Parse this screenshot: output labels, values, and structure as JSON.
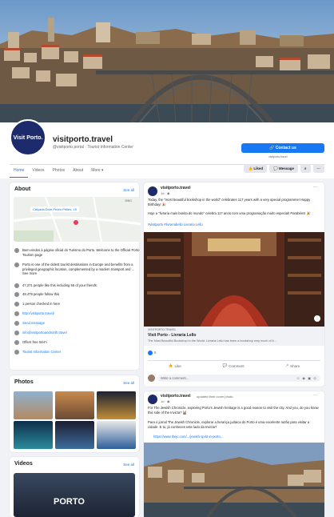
{
  "page": {
    "name": "visitporto.travel",
    "handle": "@visitporto.portal · Tourist Information Center",
    "avatar_text": [
      "Visit",
      "Porto."
    ],
    "contact_label": "Contact us",
    "contact_sub": "visitporto.travel",
    "tabs": [
      "Home",
      "Videos",
      "Photos",
      "About",
      "More ▾"
    ],
    "liked_label": "Liked",
    "message_label": "Message"
  },
  "about": {
    "title": "About",
    "see_all": "See all",
    "map_label": "Calçada Dom Pedro Pitões, 15",
    "map_watermark": "BING",
    "rows": [
      "Bem-vindos à página oficial do Turismo do Porto. Welcome to the Official Porto Tourism page",
      "Porto is one of the oldest tourist destinations in Europe and benefits from a privileged geographic location, complemented by a modern transport and ... See more",
      "47,271 people like this including 55 of your friends",
      "48,479 people follow this",
      "1 person checked in here",
      "http://visitporto.travel/",
      "Send message",
      "info@visitportoandnorth.travel",
      "Offers free Wi-Fi",
      "Tourist Information Center"
    ]
  },
  "photos": {
    "title": "Photos",
    "see_all": "See all"
  },
  "videos": {
    "title": "Videos",
    "see_all": "See all",
    "thumb_text": "PORTO"
  },
  "post1": {
    "author": "visitporto.travel",
    "time": "1d · ◉",
    "text_en": "Today, the \"most beautiful bookshop in the world\" celebrates 117 years with a very special programme! Happy Birthday! 🎉",
    "text_pt": "Hoje a \"livraria mais bonita do mundo\" celebra 117 anos com uma programação muito especial! Parabéns! 🎉",
    "tags": "#visitporto #livrariabello Livraria Lello",
    "link_domain": "VISITPORTO.TRAVEL",
    "link_title": "Visit Porto - Livraria Lello",
    "link_desc": "The Most Beautiful Bookshop in the World. Livraria Lello has been a bookshop very much of it...",
    "reactions": "5",
    "actions": [
      "Like",
      "Comment",
      "Share"
    ],
    "comment_placeholder": "Write a comment..."
  },
  "post2": {
    "author": "visitporto.travel",
    "updated": "updated their cover photo.",
    "time": "1d · ◉",
    "text_en": "For The Jewish Chronicle, exploring Porto's Jewish heritage is a good reason to visit the city. And you, do you know this side of the Invicta? 🕍",
    "text_pt": "Para o jornal The Jewish Chronicle, explorar a herança judaica do Porto é uma excelente razão para visitar a cidade. E tu, já conheces este lado da Invicta?",
    "link": "https://www.thejc.com/.../jewish-spirit-in-porto..."
  }
}
